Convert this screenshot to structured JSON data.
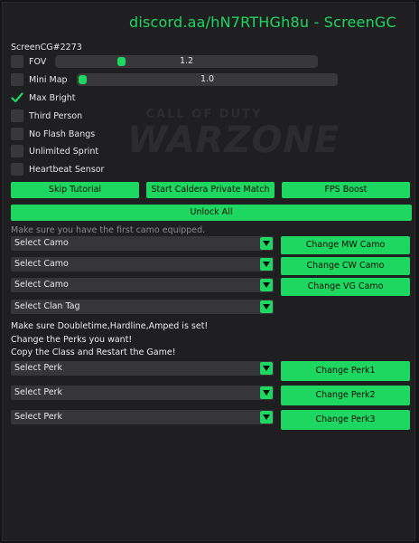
{
  "title": "discord.aa/hN7RTHGh8u - ScreenGC",
  "watermark": {
    "line1": "CALL OF DUTY",
    "line2": "WARZONE"
  },
  "user_label": "ScreenCG#2273",
  "options": {
    "fov": {
      "label": "FOV",
      "checked": false,
      "slider_value": "1.2",
      "slider_level": 0.24
    },
    "mini_map": {
      "label": "Mini Map",
      "checked": false,
      "slider_value": "1.0",
      "slider_level": 0.0
    },
    "max_bright": {
      "label": "Max Bright",
      "checked": true
    },
    "third_person": {
      "label": "Third Person",
      "checked": false
    },
    "no_flash": {
      "label": "No Flash Bangs",
      "checked": false
    },
    "unlimited_sprint": {
      "label": "Unlimited Sprint",
      "checked": false
    },
    "heartbeat": {
      "label": "Heartbeat Sensor",
      "checked": false
    }
  },
  "buttons": {
    "skip_tutorial": "Skip Tutorial",
    "caldera": "Start Caldera Private Match",
    "fps_boost": "FPS Boost",
    "unlock_all": "Unlock All"
  },
  "camo": {
    "hint": "Make sure you have the first camo equipped.",
    "select1": "Select Camo",
    "select2": "Select Camo",
    "select3": "Select Camo",
    "clan_tag": "Select Clan Tag",
    "btn_mw": "Change MW Camo",
    "btn_cw": "Change CW Camo",
    "btn_vg": "Change VG Camo"
  },
  "perks": {
    "note1": "Make sure Doubletime,Hardline,Amped is set!",
    "note2": "Change the Perks you want!",
    "note3": "Copy the Class and Restart the Game!",
    "select1": "Select Perk",
    "select2": "Select Perk",
    "select3": "Select Perk",
    "btn1": "Change Perk1",
    "btn2": "Change Perk2",
    "btn3": "Change Perk3"
  },
  "colors": {
    "accent": "#1ed760",
    "bg": "#1f1f22",
    "control": "#38383c"
  },
  "icons": {
    "check": "check-icon",
    "arrow": "triangle-down-icon"
  }
}
